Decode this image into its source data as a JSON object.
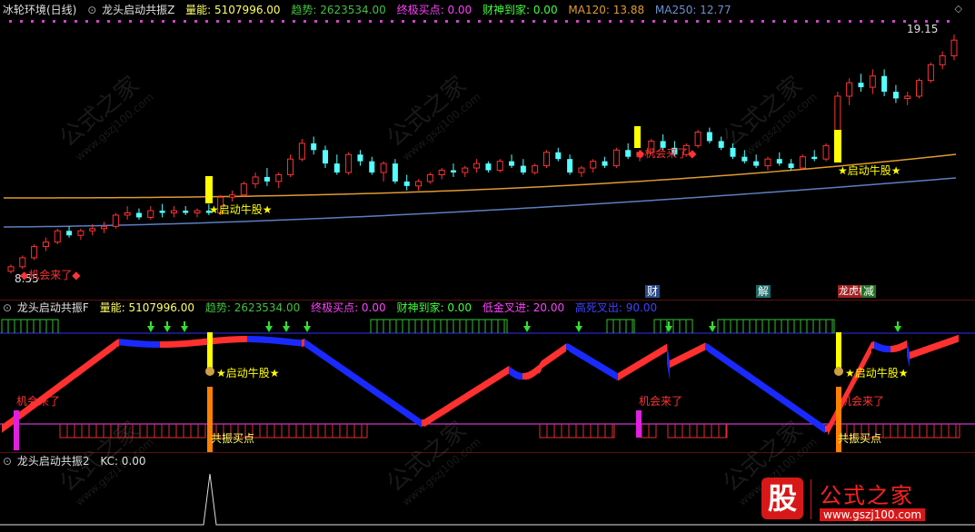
{
  "main_panel": {
    "title": "冰轮环境(日线)",
    "indicator": "龙头启动共振Z",
    "volume_label": "量能: 5107996.00",
    "trend_label": "趋势: 2623534.00",
    "final_buy_label": "终极买点: 0.00",
    "money_label": "财神到家: 0.00",
    "ma120_label": "MA120: 13.88",
    "ma250_label": "MA250: 12.77",
    "high_price": "19.15",
    "low_price": "8.55",
    "signal_start": "★启动牛股★",
    "signal_chance": "◆机会来了◆",
    "colors": {
      "up": "#ff3333",
      "down": "#54ffff",
      "ma120": "#e09a30",
      "ma250": "#5a7fc0",
      "signal": "#ffff00",
      "dots": "#d040d0"
    }
  },
  "markers": {
    "cai": "财",
    "jie": "解",
    "lhb": "龙虎榜",
    "jian": "减"
  },
  "sub_panel1": {
    "indicator": "龙头启动共振F",
    "volume_label": "量能: 5107996.00",
    "trend_label": "趋势: 2623534.00",
    "final_buy_label": "终极买点: 0.00",
    "money_label": "财神到家: 0.00",
    "low_buy_label": "低金叉进: 20.00",
    "high_sell_label": "高死叉出: 90.00",
    "start_label": "★启动牛股★",
    "chance_label": "机会来了",
    "resonance_label": "共振买点"
  },
  "sub_panel2": {
    "indicator": "龙头启动共振2",
    "kc_label": "KC: 0.00"
  },
  "watermark": {
    "text": "公式之家",
    "url": "www.gszj100.com"
  },
  "logo": {
    "badge": "股",
    "name": "公式之家",
    "url": "www.gszj100.com"
  },
  "chart_data": {
    "type": "candlestick",
    "title": "冰轮环境(日线)",
    "ylim": [
      8.55,
      19.15
    ],
    "candles": [
      [
        8.6,
        8.9,
        8.5,
        8.8
      ],
      [
        8.8,
        9.3,
        8.7,
        9.2
      ],
      [
        9.2,
        9.8,
        9.1,
        9.7
      ],
      [
        9.7,
        10.1,
        9.5,
        9.9
      ],
      [
        9.9,
        10.5,
        9.8,
        10.4
      ],
      [
        10.4,
        10.6,
        10.1,
        10.2
      ],
      [
        10.2,
        10.5,
        10.0,
        10.4
      ],
      [
        10.4,
        10.7,
        10.2,
        10.5
      ],
      [
        10.5,
        10.8,
        10.3,
        10.6
      ],
      [
        10.6,
        11.2,
        10.5,
        11.1
      ],
      [
        11.1,
        11.5,
        10.9,
        11.2
      ],
      [
        11.2,
        11.4,
        10.9,
        11.0
      ],
      [
        11.0,
        11.5,
        10.9,
        11.3
      ],
      [
        11.3,
        11.6,
        11.0,
        11.2
      ],
      [
        11.2,
        11.5,
        11.0,
        11.3
      ],
      [
        11.3,
        11.5,
        11.1,
        11.2
      ],
      [
        11.2,
        11.4,
        11.0,
        11.3
      ],
      [
        11.3,
        11.6,
        11.1,
        11.2
      ],
      [
        11.2,
        12.0,
        11.1,
        11.9
      ],
      [
        11.9,
        12.2,
        11.7,
        12.0
      ],
      [
        12.0,
        12.6,
        11.9,
        12.5
      ],
      [
        12.5,
        13.0,
        12.3,
        12.8
      ],
      [
        12.8,
        13.2,
        12.4,
        12.6
      ],
      [
        12.6,
        13.0,
        12.3,
        12.9
      ],
      [
        12.9,
        13.8,
        12.8,
        13.6
      ],
      [
        13.6,
        14.5,
        13.5,
        14.3
      ],
      [
        14.3,
        14.6,
        13.8,
        14.0
      ],
      [
        14.0,
        14.2,
        13.2,
        13.4
      ],
      [
        13.4,
        13.8,
        12.9,
        13.0
      ],
      [
        13.0,
        13.9,
        12.9,
        13.8
      ],
      [
        13.8,
        14.0,
        13.3,
        13.5
      ],
      [
        13.5,
        13.7,
        12.9,
        13.0
      ],
      [
        13.0,
        13.5,
        12.6,
        13.4
      ],
      [
        13.4,
        13.6,
        12.5,
        12.6
      ],
      [
        12.6,
        12.9,
        12.2,
        12.4
      ],
      [
        12.4,
        12.7,
        12.2,
        12.6
      ],
      [
        12.6,
        13.0,
        12.5,
        12.9
      ],
      [
        12.9,
        13.2,
        12.7,
        13.1
      ],
      [
        13.1,
        13.4,
        12.8,
        13.0
      ],
      [
        13.0,
        13.3,
        12.8,
        13.2
      ],
      [
        13.2,
        13.6,
        13.0,
        13.4
      ],
      [
        13.4,
        13.5,
        13.0,
        13.1
      ],
      [
        13.1,
        13.6,
        13.0,
        13.5
      ],
      [
        13.5,
        13.8,
        13.2,
        13.3
      ],
      [
        13.3,
        13.6,
        12.9,
        13.0
      ],
      [
        13.0,
        13.4,
        12.9,
        13.3
      ],
      [
        13.3,
        14.0,
        13.2,
        13.9
      ],
      [
        13.9,
        14.1,
        13.5,
        13.6
      ],
      [
        13.6,
        13.8,
        12.9,
        13.0
      ],
      [
        13.0,
        13.3,
        12.8,
        13.2
      ],
      [
        13.2,
        13.6,
        13.0,
        13.5
      ],
      [
        13.5,
        13.7,
        13.2,
        13.3
      ],
      [
        13.3,
        14.1,
        13.2,
        14.0
      ],
      [
        14.0,
        14.3,
        13.6,
        13.7
      ],
      [
        13.7,
        14.0,
        13.5,
        13.9
      ],
      [
        13.9,
        14.5,
        13.8,
        14.4
      ],
      [
        14.4,
        14.7,
        14.0,
        14.1
      ],
      [
        14.1,
        14.4,
        13.7,
        13.8
      ],
      [
        13.8,
        14.3,
        13.7,
        14.2
      ],
      [
        14.2,
        14.9,
        14.1,
        14.8
      ],
      [
        14.8,
        15.0,
        14.3,
        14.4
      ],
      [
        14.4,
        14.6,
        14.0,
        14.1
      ],
      [
        14.1,
        14.3,
        13.6,
        13.7
      ],
      [
        13.7,
        14.0,
        13.4,
        13.5
      ],
      [
        13.5,
        13.8,
        13.2,
        13.3
      ],
      [
        13.3,
        13.7,
        13.1,
        13.6
      ],
      [
        13.6,
        13.9,
        13.3,
        13.4
      ],
      [
        13.4,
        13.6,
        13.1,
        13.2
      ],
      [
        13.2,
        13.8,
        13.1,
        13.7
      ],
      [
        13.7,
        14.0,
        13.5,
        13.6
      ],
      [
        13.6,
        14.3,
        13.5,
        14.2
      ],
      [
        14.2,
        16.6,
        14.1,
        16.4
      ],
      [
        16.4,
        17.2,
        16.0,
        17.0
      ],
      [
        17.0,
        17.4,
        16.6,
        16.8
      ],
      [
        16.8,
        17.6,
        16.5,
        17.3
      ],
      [
        17.3,
        17.6,
        16.4,
        16.6
      ],
      [
        16.6,
        16.9,
        16.1,
        16.3
      ],
      [
        16.3,
        16.6,
        16.0,
        16.4
      ],
      [
        16.4,
        17.2,
        16.3,
        17.1
      ],
      [
        17.1,
        17.9,
        17.0,
        17.8
      ],
      [
        17.8,
        18.4,
        17.6,
        18.2
      ],
      [
        18.2,
        19.15,
        18.0,
        18.9
      ]
    ]
  }
}
